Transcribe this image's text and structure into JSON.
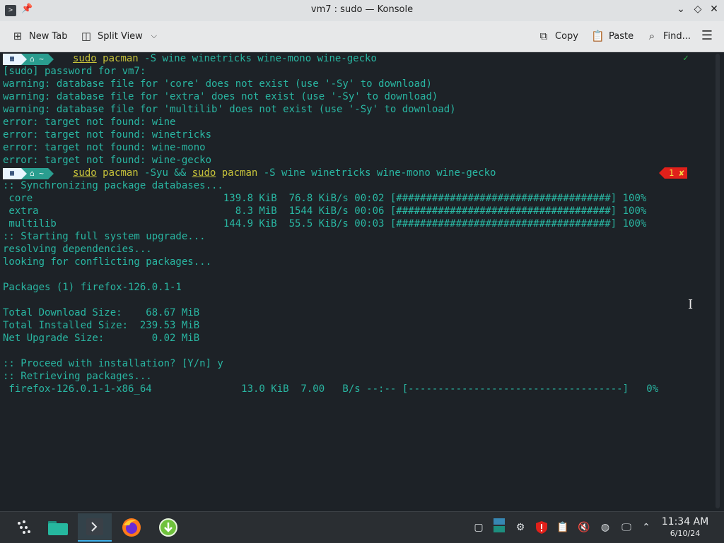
{
  "window": {
    "title": "vm7 : sudo — Konsole"
  },
  "toolbar": {
    "new_tab": "New Tab",
    "split_view": "Split View",
    "copy": "Copy",
    "paste": "Paste",
    "find": "Find..."
  },
  "prompt": {
    "home": "~"
  },
  "terminal": {
    "cmd1_rest": " -S wine winetricks wine-mono wine-gecko",
    "cmd2_mid": " -Syu && ",
    "cmd2_rest": " -S wine winetricks wine-mono wine-gecko",
    "sudo": "sudo",
    "pacman": "pacman",
    "status_ok": "✓",
    "status_err": "1 ✘",
    "lines": [
      "[sudo] password for vm7:",
      "warning: database file for 'core' does not exist (use '-Sy' to download)",
      "warning: database file for 'extra' does not exist (use '-Sy' to download)",
      "warning: database file for 'multilib' does not exist (use '-Sy' to download)",
      "error: target not found: wine",
      "error: target not found: winetricks",
      "error: target not found: wine-mono",
      "error: target not found: wine-gecko",
      ":: Synchronizing package databases...",
      " core                                139.8 KiB  76.8 KiB/s 00:02 [####################################] 100%",
      " extra                                 8.3 MiB  1544 KiB/s 00:06 [####################################] 100%",
      " multilib                            144.9 KiB  55.5 KiB/s 00:03 [####################################] 100%",
      ":: Starting full system upgrade...",
      "resolving dependencies...",
      "looking for conflicting packages...",
      "Packages (1) firefox-126.0.1-1",
      "Total Download Size:    68.67 MiB",
      "Total Installed Size:  239.53 MiB",
      "Net Upgrade Size:        0.02 MiB",
      ":: Proceed with installation? [Y/n] y",
      ":: Retrieving packages...",
      " firefox-126.0.1-1-x86_64               13.0 KiB  7.00   B/s --:-- [------------------------------------]   0%"
    ]
  },
  "clock": {
    "time": "11:34 AM",
    "date": "6/10/24"
  },
  "colors": {
    "accent": "#3daee9",
    "terminal_text": "#29b6a2",
    "error_badge": "#e0201a",
    "ok": "#2bb34a"
  }
}
